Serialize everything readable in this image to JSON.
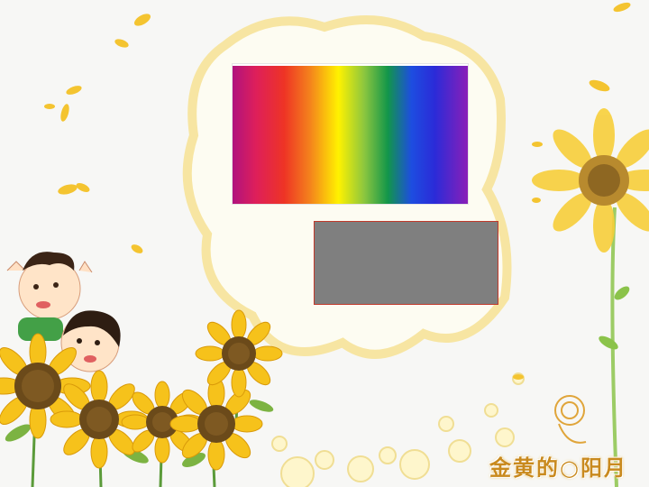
{
  "slide": {
    "brand_text": "金黄的○阳月"
  },
  "colors": {
    "spectrum": [
      "#b0127e",
      "#de1f5a",
      "#ee3425",
      "#f4831c",
      "#fff200",
      "#8bc63f",
      "#12964a",
      "#1d4de0",
      "#2b2bd8",
      "#8a1fb8"
    ],
    "gray_box": "#7f7f7f",
    "sunflower_petal": "#f6c21b",
    "sunflower_center": "#6b4a1a"
  },
  "icons": [
    "sunflower-icon",
    "children-illustration",
    "leaf-icon",
    "petal-icon",
    "bubble-icon"
  ]
}
